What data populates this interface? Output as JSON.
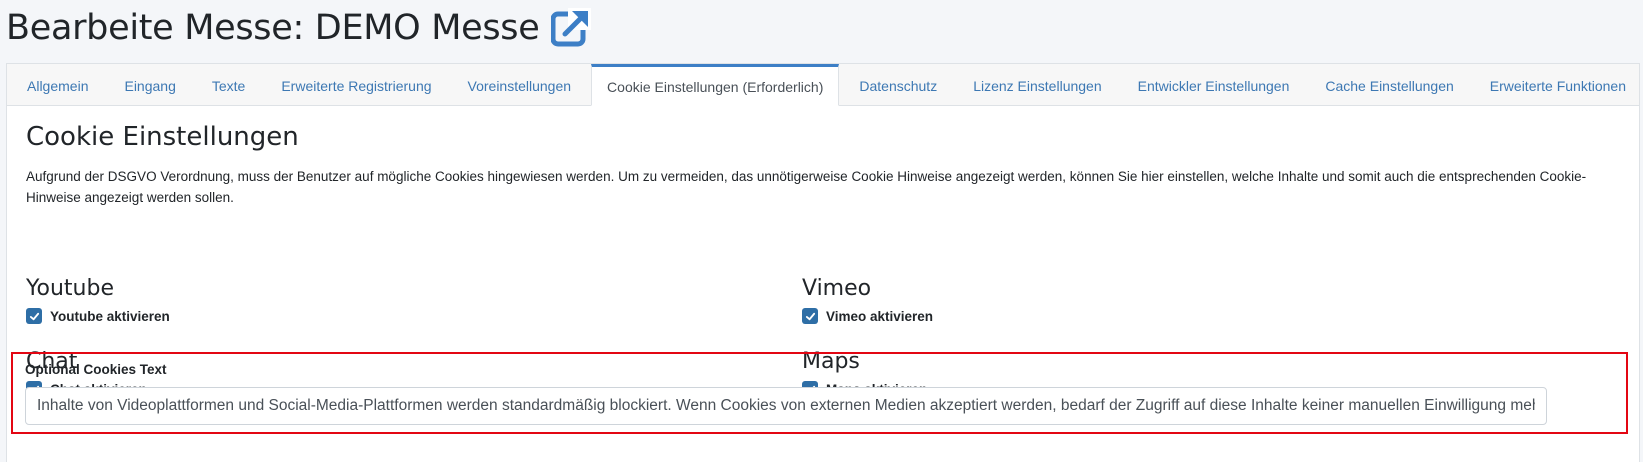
{
  "header": {
    "title": "Bearbeite Messe: DEMO Messe",
    "icon": "external-link-icon",
    "accent_color": "#3d7fc6"
  },
  "tabs": [
    {
      "label": "Allgemein",
      "active": false
    },
    {
      "label": "Eingang",
      "active": false
    },
    {
      "label": "Texte",
      "active": false
    },
    {
      "label": "Erweiterte Registrierung",
      "active": false
    },
    {
      "label": "Voreinstellungen",
      "active": false
    },
    {
      "label": "Cookie Einstellungen (Erforderlich)",
      "active": true
    },
    {
      "label": "Datenschutz",
      "active": false
    },
    {
      "label": "Lizenz Einstellungen",
      "active": false
    },
    {
      "label": "Entwickler Einstellungen",
      "active": false
    },
    {
      "label": "Cache Einstellungen",
      "active": false
    },
    {
      "label": "Erweiterte Funktionen",
      "active": false
    }
  ],
  "cookie_settings": {
    "title": "Cookie Einstellungen",
    "description": "Aufgrund der DSGVO Verordnung, muss der Benutzer auf mögliche Cookies hingewiesen werden. Um zu vermeiden, das unnötigerweise Cookie Hinweise angezeigt werden, können Sie hier einstellen, welche Inhalte und somit auch die entsprechenden Cookie-Hinweise angezeigt werden sollen.",
    "groups": {
      "youtube": {
        "title": "Youtube",
        "checkbox_label": "Youtube aktivieren",
        "checked": true
      },
      "vimeo": {
        "title": "Vimeo",
        "checkbox_label": "Vimeo aktivieren",
        "checked": true
      },
      "chat": {
        "title": "Chat",
        "checkbox_label": "Chat aktivieren",
        "checked": true
      },
      "maps": {
        "title": "Maps",
        "checkbox_label": "Maps aktivieren",
        "checked": true
      }
    },
    "optional_cookies": {
      "label": "Optional Cookies Text",
      "value": "Inhalte von Videoplattformen und Social-Media-Plattformen werden standardmäßig blockiert. Wenn Cookies von externen Medien akzeptiert werden, bedarf der Zugriff auf diese Inhalte keiner manuellen Einwilligung mehr.",
      "highlight_color": "#e30613"
    }
  }
}
